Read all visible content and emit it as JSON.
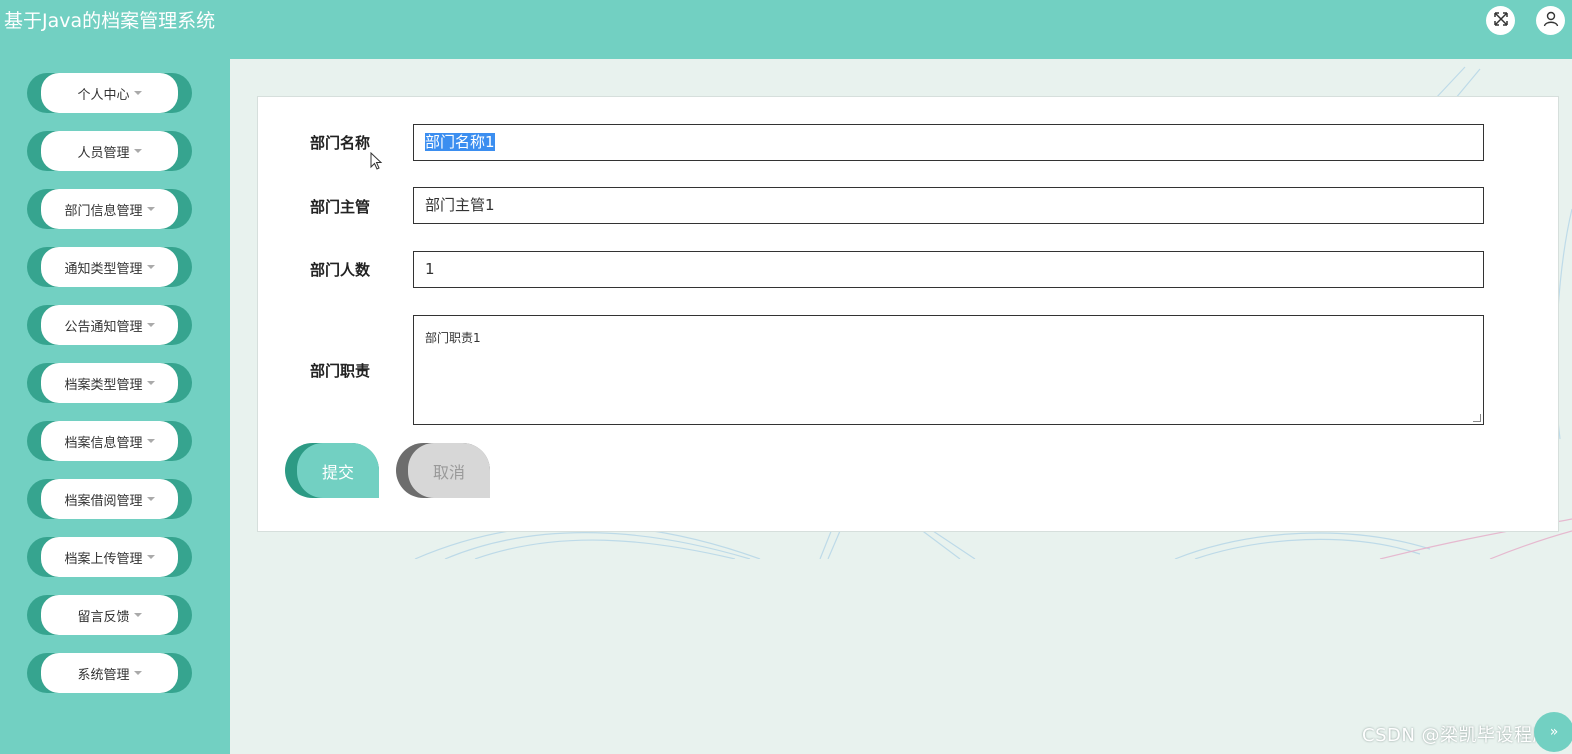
{
  "header": {
    "title": "基于Java的档案管理系统",
    "fullscreen_icon": "expand-icon",
    "user_icon": "user-icon"
  },
  "sidebar": {
    "items": [
      {
        "label": "个人中心"
      },
      {
        "label": "人员管理"
      },
      {
        "label": "部门信息管理"
      },
      {
        "label": "通知类型管理"
      },
      {
        "label": "公告通知管理"
      },
      {
        "label": "档案类型管理"
      },
      {
        "label": "档案信息管理"
      },
      {
        "label": "档案借阅管理"
      },
      {
        "label": "档案上传管理"
      },
      {
        "label": "留言反馈"
      },
      {
        "label": "系统管理"
      }
    ]
  },
  "form": {
    "fields": [
      {
        "label": "部门名称",
        "value": "部门名称1"
      },
      {
        "label": "部门主管",
        "value": "部门主管1"
      },
      {
        "label": "部门人数",
        "value": "1"
      },
      {
        "label": "部门职责",
        "value": "部门职责1"
      }
    ],
    "submit_label": "提交",
    "cancel_label": "取消"
  },
  "watermark": "CSDN @梁凯毕设程序",
  "colors": {
    "header_bg": "#72d0c2",
    "menu_accent": "#36a48f",
    "page_bg": "#e8f2ee",
    "selection": "#3b8ef0",
    "cancel_bg": "#d7d7d7"
  }
}
